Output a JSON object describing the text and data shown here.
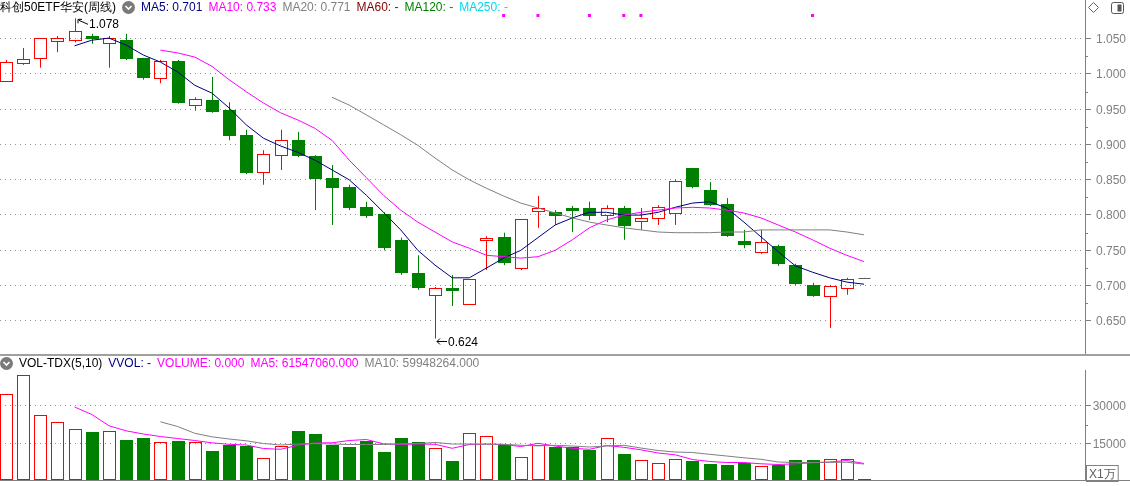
{
  "header": {
    "title": "科创50ETF华安(周线)",
    "legend": [
      {
        "text": "MA5: 0.701",
        "color": "#000080"
      },
      {
        "text": "MA10: 0.733",
        "color": "#ff00ff"
      },
      {
        "text": "MA20: 0.771",
        "color": "#808080"
      },
      {
        "text": "MA60: -",
        "color": "#800000"
      },
      {
        "text": "MA120: -",
        "color": "#008000"
      },
      {
        "text": "MA250: -",
        "color": "#00d8f0"
      }
    ]
  },
  "price_chart": {
    "chart_data": {
      "type": "candlestick",
      "grid": true,
      "categories": [
        null,
        null,
        null,
        null,
        null,
        null,
        null,
        null,
        null,
        null,
        null,
        null,
        null,
        null,
        null,
        null,
        null,
        null,
        null,
        null,
        null,
        null,
        null,
        null,
        null,
        null,
        null,
        null,
        null,
        null,
        null,
        null,
        null,
        null,
        null,
        null,
        null,
        null,
        null,
        null,
        null,
        null,
        null,
        null,
        null,
        null,
        null,
        null,
        null,
        null,
        null
      ],
      "ylim": [
        0.602,
        1.104
      ],
      "yticks": [
        {
          "value": 0.65,
          "label": "0.650"
        },
        {
          "value": 0.7,
          "label": "0.700"
        },
        {
          "value": 0.75,
          "label": "0.750"
        },
        {
          "value": 0.8,
          "label": "0.800"
        },
        {
          "value": 0.85,
          "label": "0.850"
        },
        {
          "value": 0.9,
          "label": "0.900"
        },
        {
          "value": 0.95,
          "label": "0.950"
        },
        {
          "value": 1.0,
          "label": "1.000"
        },
        {
          "value": 1.05,
          "label": "1.050"
        }
      ],
      "ohlc": [
        [
          0.989,
          1.019,
          0.989,
          1.016
        ],
        [
          1.015,
          1.036,
          1.012,
          1.02
        ],
        [
          1.022,
          1.05,
          1.008,
          1.05
        ],
        [
          1.046,
          1.053,
          1.03,
          1.05
        ],
        [
          1.047,
          1.078,
          1.044,
          1.06
        ],
        [
          1.053,
          1.056,
          1.042,
          1.05
        ],
        [
          1.043,
          1.053,
          1.008,
          1.05
        ],
        [
          1.047,
          1.056,
          1.019,
          1.022
        ],
        [
          1.022,
          1.022,
          0.991,
          0.995
        ],
        [
          0.993,
          1.019,
          0.986,
          1.018
        ],
        [
          1.018,
          1.019,
          0.957,
          0.959
        ],
        [
          0.955,
          0.966,
          0.947,
          0.964
        ],
        [
          0.962,
          0.995,
          0.944,
          0.947
        ],
        [
          0.948,
          0.959,
          0.905,
          0.913
        ],
        [
          0.913,
          0.92,
          0.857,
          0.86
        ],
        [
          0.86,
          0.891,
          0.842,
          0.886
        ],
        [
          0.884,
          0.92,
          0.863,
          0.905
        ],
        [
          0.905,
          0.917,
          0.881,
          0.884
        ],
        [
          0.883,
          0.884,
          0.806,
          0.852
        ],
        [
          0.852,
          0.87,
          0.785,
          0.839
        ],
        [
          0.839,
          0.842,
          0.806,
          0.81
        ],
        [
          0.81,
          0.818,
          0.795,
          0.799
        ],
        [
          0.801,
          0.803,
          0.749,
          0.754
        ],
        [
          0.764,
          0.767,
          0.714,
          0.718
        ],
        [
          0.717,
          0.742,
          0.693,
          0.697
        ],
        [
          0.686,
          0.697,
          0.624,
          0.696
        ],
        [
          0.696,
          0.714,
          0.67,
          0.693
        ],
        [
          0.673,
          0.708,
          0.673,
          0.708
        ],
        [
          0.764,
          0.769,
          0.721,
          0.767
        ],
        [
          0.768,
          0.774,
          0.728,
          0.733
        ],
        [
          0.724,
          0.793,
          0.721,
          0.793
        ],
        [
          0.805,
          0.826,
          0.781,
          0.809
        ],
        [
          0.803,
          0.806,
          0.785,
          0.799
        ],
        [
          0.809,
          0.812,
          0.775,
          0.806
        ],
        [
          0.809,
          0.818,
          0.792,
          0.799
        ],
        [
          0.799,
          0.813,
          0.789,
          0.809
        ],
        [
          0.809,
          0.812,
          0.764,
          0.785
        ],
        [
          0.791,
          0.809,
          0.778,
          0.795
        ],
        [
          0.795,
          0.813,
          0.785,
          0.81
        ],
        [
          0.802,
          0.849,
          0.785,
          0.847
        ],
        [
          0.866,
          0.866,
          0.837,
          0.84
        ],
        [
          0.835,
          0.846,
          0.812,
          0.815
        ],
        [
          0.815,
          0.823,
          0.768,
          0.771
        ],
        [
          0.762,
          0.778,
          0.752,
          0.758
        ],
        [
          0.747,
          0.778,
          0.744,
          0.761
        ],
        [
          0.755,
          0.757,
          0.727,
          0.731
        ],
        [
          0.728,
          0.73,
          0.7,
          0.703
        ],
        [
          0.7,
          0.703,
          0.683,
          0.686
        ],
        [
          0.684,
          0.7,
          0.639,
          0.698
        ],
        [
          0.696,
          0.71,
          0.686,
          0.708
        ],
        [
          0.71,
          0.71,
          0.71,
          0.71
        ]
      ],
      "series": [
        {
          "type": "line",
          "color": "#000080",
          "values": [
            null,
            null,
            null,
            null,
            1.039,
            1.047,
            1.05,
            1.04,
            1.026,
            1.016,
            1.002,
            0.983,
            0.972,
            0.951,
            0.927,
            0.908,
            0.897,
            0.888,
            0.877,
            0.863,
            0.849,
            0.827,
            0.803,
            0.778,
            0.749,
            0.728,
            0.71,
            0.71,
            0.724,
            0.738,
            0.749,
            0.767,
            0.785,
            0.795,
            0.803,
            0.803,
            0.799,
            0.799,
            0.803,
            0.81,
            0.816,
            0.818,
            0.809,
            0.789,
            0.768,
            0.747,
            0.727,
            0.718,
            0.71,
            0.704,
            0.701
          ]
        },
        {
          "type": "line",
          "color": "#ff00ff",
          "values": [
            null,
            null,
            null,
            null,
            null,
            null,
            null,
            null,
            null,
            1.033,
            1.029,
            1.023,
            1.01,
            0.991,
            0.974,
            0.958,
            0.944,
            0.934,
            0.922,
            0.905,
            0.877,
            0.852,
            0.827,
            0.806,
            0.789,
            0.775,
            0.761,
            0.752,
            0.742,
            0.74,
            0.738,
            0.74,
            0.749,
            0.764,
            0.781,
            0.792,
            0.799,
            0.803,
            0.806,
            0.809,
            0.81,
            0.809,
            0.806,
            0.802,
            0.795,
            0.785,
            0.775,
            0.764,
            0.752,
            0.742,
            0.733
          ]
        },
        {
          "type": "line",
          "color": "#808080",
          "values": [
            null,
            null,
            null,
            null,
            null,
            null,
            null,
            null,
            null,
            null,
            null,
            null,
            null,
            null,
            null,
            null,
            null,
            null,
            null,
            0.966,
            0.955,
            0.941,
            0.927,
            0.913,
            0.898,
            0.88,
            0.863,
            0.849,
            0.837,
            0.826,
            0.816,
            0.809,
            0.802,
            0.795,
            0.789,
            0.785,
            0.781,
            0.778,
            0.775,
            0.774,
            0.774,
            0.774,
            0.775,
            0.775,
            0.778,
            0.778,
            0.778,
            0.778,
            0.778,
            0.775,
            0.771
          ]
        }
      ],
      "annotations": [
        "1.078",
        "0.624"
      ]
    }
  },
  "volume_header": {
    "title": "VOL-TDX(5,10)",
    "legend": [
      {
        "text": "VVOL: -",
        "color": "#000080"
      },
      {
        "text": "VOLUME: 0.000",
        "color": "#ff00ff"
      },
      {
        "text": "MA5: 61547060.000",
        "color": "#ff00ff"
      },
      {
        "text": "MA10: 59948264.000",
        "color": "#808080"
      }
    ]
  },
  "volume_chart": {
    "unit": "X1万",
    "chart_data": {
      "type": "bar",
      "grid": true,
      "categories": [
        null,
        null,
        null,
        null,
        null,
        null,
        null,
        null,
        null,
        null,
        null,
        null,
        null,
        null,
        null,
        null,
        null,
        null,
        null,
        null,
        null,
        null,
        null,
        null,
        null,
        null,
        null,
        null,
        null,
        null,
        null,
        null,
        null,
        null,
        null,
        null,
        null,
        null,
        null,
        null,
        null,
        null,
        null,
        null,
        null,
        null,
        null,
        null,
        null,
        null,
        null
      ],
      "ylim": [
        0,
        44000
      ],
      "yticks": [
        {
          "value": 15000,
          "label": "15000"
        },
        {
          "value": 30000,
          "label": "30000"
        }
      ],
      "series": [
        {
          "color": "#ff0000",
          "values": [
            34400,
            42000,
            26000,
            23200,
            20400,
            null,
            19600,
            null,
            null,
            15200,
            null,
            15200,
            null,
            null,
            null,
            8800,
            13600,
            null,
            null,
            null,
            null,
            null,
            null,
            null,
            null,
            12800,
            null,
            18800,
            17600,
            null,
            9200,
            14000,
            null,
            null,
            null,
            16800,
            null,
            8000,
            6800,
            8400,
            null,
            null,
            null,
            null,
            5600,
            null,
            null,
            null,
            8400,
            8400,
            0
          ]
        },
        {
          "color": "#008000",
          "values": [
            null,
            null,
            null,
            null,
            null,
            19200,
            null,
            16000,
            16800,
            null,
            15600,
            null,
            11600,
            14000,
            13600,
            null,
            null,
            19600,
            18400,
            14000,
            13200,
            15600,
            11200,
            16800,
            15200,
            null,
            7600,
            null,
            null,
            14000,
            null,
            null,
            13200,
            13200,
            12000,
            null,
            10400,
            null,
            null,
            null,
            7600,
            6400,
            6000,
            6800,
            null,
            6000,
            8000,
            8000,
            null,
            null,
            null
          ]
        },
        {
          "type": "line",
          "color": "#ff00ff",
          "values": [
            null,
            null,
            null,
            null,
            29200,
            26200,
            21700,
            19700,
            18400,
            17400,
            16600,
            15800,
            14900,
            14300,
            14000,
            12600,
            12300,
            13900,
            14800,
            14900,
            15800,
            16200,
            14500,
            14200,
            14400,
            14300,
            12700,
            14200,
            14400,
            14200,
            13400,
            14700,
            13600,
            12700,
            12300,
            13800,
            13100,
            12100,
            10800,
            10100,
            8200,
            7400,
            7000,
            7000,
            6500,
            6200,
            6500,
            6900,
            7200,
            7800,
            6600
          ]
        },
        {
          "type": "line",
          "color": "#808080",
          "values": [
            null,
            null,
            null,
            null,
            null,
            null,
            null,
            null,
            null,
            23300,
            21400,
            18700,
            17300,
            16400,
            15700,
            14600,
            14000,
            14400,
            14600,
            14400,
            14200,
            14200,
            14200,
            14500,
            14600,
            15000,
            14400,
            14400,
            14300,
            14300,
            13900,
            13700,
            13900,
            13600,
            13200,
            13600,
            13900,
            12800,
            11800,
            11200,
            11000,
            10300,
            9600,
            8900,
            8300,
            7200,
            7000,
            7000,
            7100,
            7100,
            6400
          ]
        }
      ]
    }
  }
}
